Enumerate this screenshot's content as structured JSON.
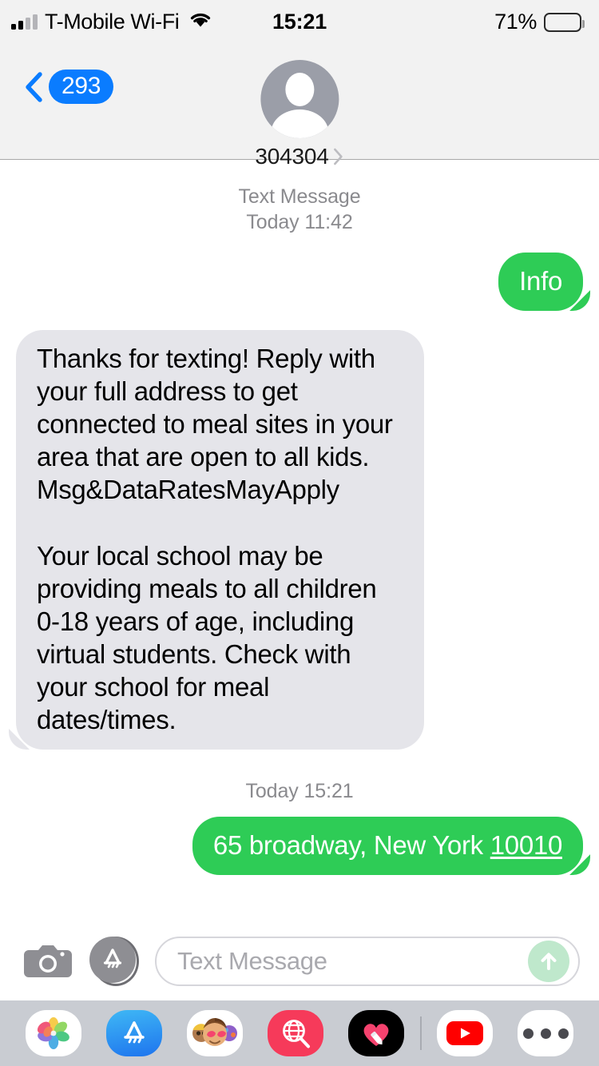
{
  "status_bar": {
    "carrier": "T-Mobile Wi-Fi",
    "wifi_icon": "wifi-icon",
    "signal_icon": "cellular-signal-icon",
    "time": "15:21",
    "battery_percent": "71%",
    "battery_icon": "battery-icon",
    "battery_level": 71
  },
  "nav_header": {
    "back_icon": "chevron-left-icon",
    "back_badge_count": "293",
    "avatar_icon": "person-avatar-icon",
    "contact_name": "304304",
    "contact_detail_icon": "chevron-right-icon"
  },
  "conversation": {
    "timestamps": [
      {
        "service": "Text Message",
        "when": "Today 11:42"
      },
      {
        "service": "",
        "when": "Today 15:21"
      }
    ],
    "messages": [
      {
        "direction": "outgoing",
        "kind": "sms",
        "text": "Info"
      },
      {
        "direction": "incoming",
        "kind": "sms",
        "text": "Thanks for texting! Reply with your full address to get connected to meal sites in your area that are open to all kids. Msg&DataRatesMayApply\n\nYour local school may be providing meals to all children 0-18 years of age, including virtual students. Check with your school for meal dates/times."
      },
      {
        "direction": "outgoing",
        "kind": "sms",
        "text_prefix": "65 broadway, New York ",
        "text_link": "10010"
      }
    ]
  },
  "input_bar": {
    "camera_icon": "camera-icon",
    "appstore_icon": "app-store-icon",
    "placeholder": "Text Message",
    "send_icon": "send-arrow-up-icon"
  },
  "app_drawer": {
    "apps": [
      {
        "name": "photos-app-icon",
        "label": "Photos"
      },
      {
        "name": "app-store-app-icon",
        "label": "App Store"
      },
      {
        "name": "memoji-stickers-app-icon",
        "label": "Memoji Stickers"
      },
      {
        "name": "images-search-app-icon",
        "label": "#images"
      },
      {
        "name": "digital-touch-app-icon",
        "label": "Digital Touch"
      },
      {
        "name": "youtube-app-icon",
        "label": "YouTube"
      },
      {
        "name": "more-apps-icon",
        "label": "More"
      }
    ]
  },
  "colors": {
    "sms_green": "#2ECC56",
    "incoming_gray": "#E5E5EA",
    "ios_blue": "#0A7CFF",
    "header_bg": "#F2F2F2",
    "drawer_bg": "#C9CCD2",
    "send_disabled": "#BFE8CC"
  }
}
